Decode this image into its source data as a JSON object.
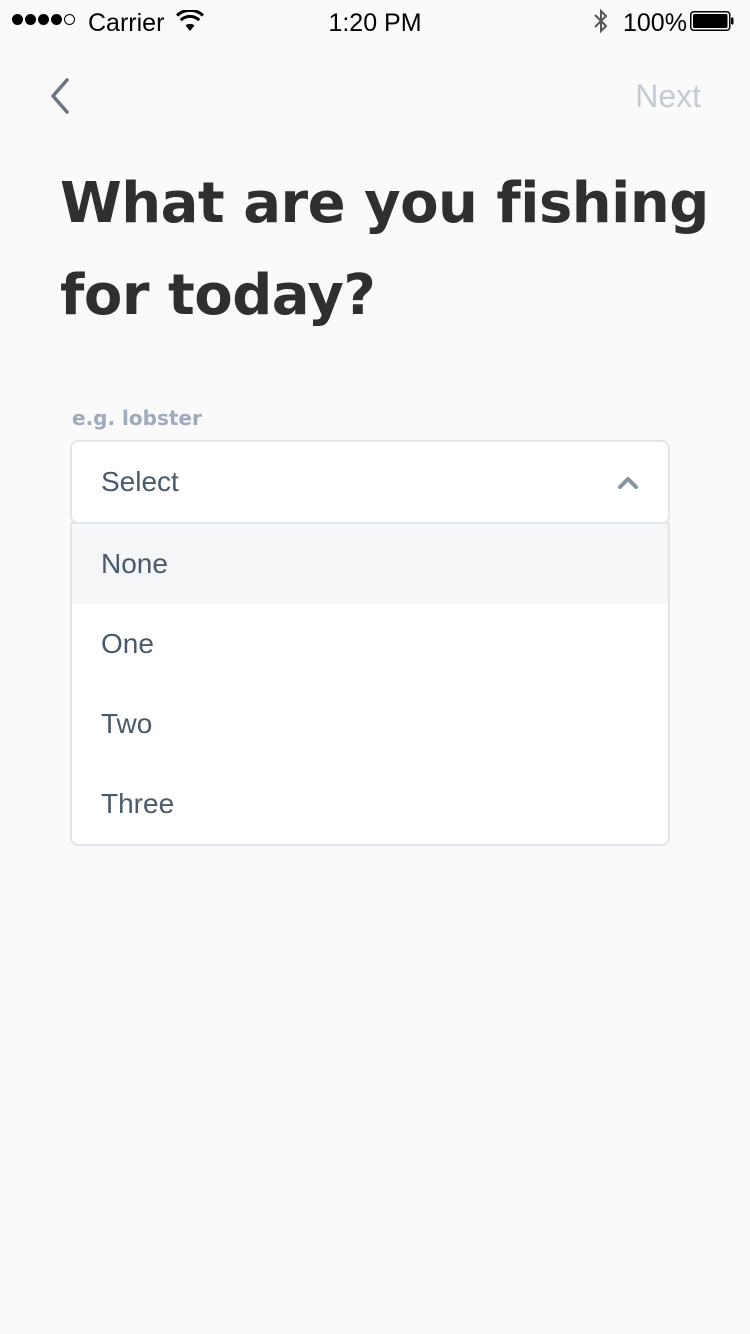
{
  "status_bar": {
    "carrier": "Carrier",
    "time": "1:20 PM",
    "battery_percent": "100%",
    "signal_bars_filled": 4,
    "signal_bars_total": 5
  },
  "nav": {
    "back_icon": "chevron-left-icon",
    "next_label": "Next"
  },
  "question": {
    "title": "What are you fishing for today?"
  },
  "field": {
    "placeholder_label": "e.g. lobster",
    "select_value": "Select",
    "expanded": true,
    "options": [
      {
        "label": "None",
        "highlighted": true
      },
      {
        "label": "One",
        "highlighted": false
      },
      {
        "label": "Two",
        "highlighted": false
      },
      {
        "label": "Three",
        "highlighted": false
      }
    ]
  },
  "colors": {
    "background": "#fafafa",
    "title": "#2f2f2f",
    "label": "#9fabbb",
    "option_text": "#4a5a6c",
    "border": "#e1e6ec",
    "highlight": "#f4f6f8",
    "next_disabled": "#c5cbd3"
  }
}
